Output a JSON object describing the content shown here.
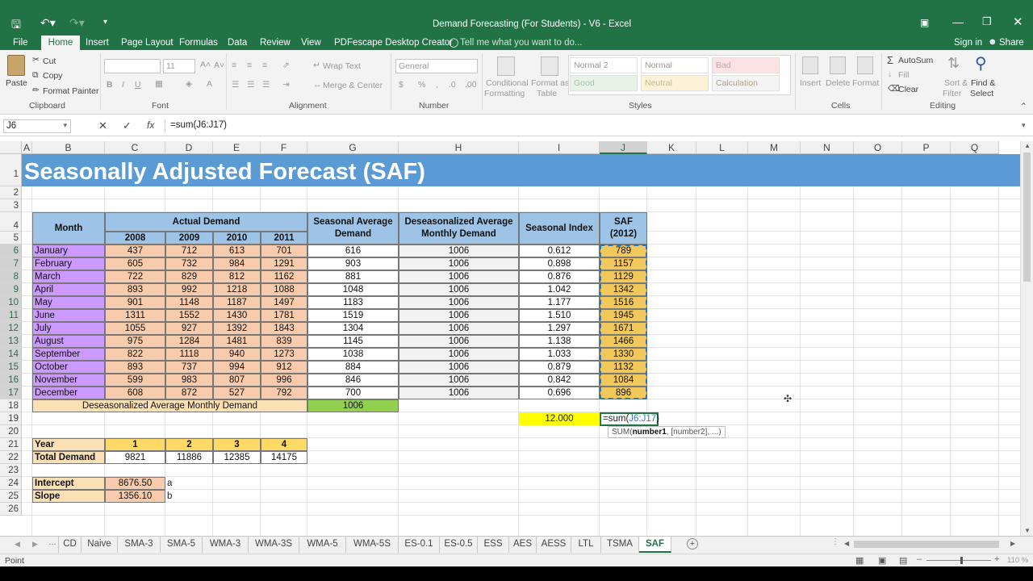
{
  "window": {
    "title": "Demand Forecasting (For Students) - V6 - Excel",
    "sign_in": "Sign in",
    "share": "Share"
  },
  "menu": {
    "items": [
      "File",
      "Home",
      "Insert",
      "Page Layout",
      "Formulas",
      "Data",
      "Review",
      "View",
      "PDFescape Desktop Creator"
    ],
    "tell_me": "Tell me what you want to do..."
  },
  "ribbon": {
    "clipboard": {
      "paste": "Paste",
      "cut": "Cut",
      "copy": "Copy",
      "format_painter": "Format Painter",
      "label": "Clipboard"
    },
    "font": {
      "size": "11",
      "label": "Font"
    },
    "alignment": {
      "wrap_text": "Wrap Text",
      "merge_center": "Merge & Center",
      "label": "Alignment"
    },
    "number": {
      "format": "General",
      "label": "Number"
    },
    "styles": {
      "conditional": [
        "Conditional",
        "Formatting"
      ],
      "format_as_table": [
        "Format as",
        "Table"
      ],
      "cells": [
        "Normal 2",
        "Normal",
        "Bad",
        "Good",
        "Neutral",
        "Calculation"
      ],
      "label": "Styles"
    },
    "cells": {
      "insert": "Insert",
      "delete": "Delete",
      "format": "Format",
      "label": "Cells"
    },
    "editing": {
      "autosum": "AutoSum",
      "fill": "Fill",
      "clear": "Clear",
      "sort": [
        "Sort &",
        "Filter"
      ],
      "find": [
        "Find &",
        "Select"
      ],
      "label": "Editing"
    }
  },
  "formula_bar": {
    "name_box": "J6",
    "formula": "=sum(J6:J17)"
  },
  "columns": [
    "A",
    "B",
    "C",
    "D",
    "E",
    "F",
    "G",
    "H",
    "I",
    "J",
    "K",
    "L",
    "M",
    "N",
    "O",
    "P",
    "Q"
  ],
  "rows": [
    "1",
    "2",
    "3",
    "4",
    "5",
    "6",
    "7",
    "8",
    "9",
    "10",
    "11",
    "12",
    "13",
    "14",
    "15",
    "16",
    "17",
    "18",
    "19",
    "20",
    "21",
    "22",
    "23",
    "24",
    "25",
    "26"
  ],
  "sheet": {
    "title": "Seasonally Adjusted Forecast (SAF)",
    "hdr": {
      "month": "Month",
      "actual": "Actual Demand",
      "years": [
        "2008",
        "2009",
        "2010",
        "2011"
      ],
      "sad": "Seasonal Average Demand",
      "dam": "Deseasonalized Average Monthly Demand",
      "si": "Seasonal Index",
      "saf": "SAF (2012)"
    },
    "months": [
      "January",
      "February",
      "March",
      "April",
      "May",
      "June",
      "July",
      "August",
      "September",
      "October",
      "November",
      "December"
    ],
    "demand": [
      [
        "437",
        "712",
        "613",
        "701"
      ],
      [
        "605",
        "732",
        "984",
        "1291"
      ],
      [
        "722",
        "829",
        "812",
        "1162"
      ],
      [
        "893",
        "992",
        "1218",
        "1088"
      ],
      [
        "901",
        "1148",
        "1187",
        "1497"
      ],
      [
        "1311",
        "1552",
        "1430",
        "1781"
      ],
      [
        "1055",
        "927",
        "1392",
        "1843"
      ],
      [
        "975",
        "1284",
        "1481",
        "839"
      ],
      [
        "822",
        "1118",
        "940",
        "1273"
      ],
      [
        "893",
        "737",
        "994",
        "912"
      ],
      [
        "599",
        "983",
        "807",
        "996"
      ],
      [
        "608",
        "872",
        "527",
        "792"
      ]
    ],
    "sad": [
      "616",
      "903",
      "881",
      "1048",
      "1183",
      "1519",
      "1304",
      "1145",
      "1038",
      "884",
      "846",
      "700"
    ],
    "dam": [
      "1006",
      "1006",
      "1006",
      "1006",
      "1006",
      "1006",
      "1006",
      "1006",
      "1006",
      "1006",
      "1006",
      "1006"
    ],
    "si": [
      "0.612",
      "0.898",
      "0.876",
      "1.042",
      "1.177",
      "1.510",
      "1.297",
      "1.138",
      "1.033",
      "0.879",
      "0.842",
      "0.696"
    ],
    "saf": [
      "789",
      "1157",
      "1129",
      "1342",
      "1516",
      "1945",
      "1671",
      "1466",
      "1330",
      "1132",
      "1084",
      "896"
    ],
    "row18": {
      "label": "Deseasonalized Average Monthly Demand",
      "value": "1006"
    },
    "row19": {
      "sum": "12.000",
      "edit_prefix": "=sum(",
      "edit_ref": "J6:J17",
      "edit_suffix": ")",
      "tooltip_fn": "SUM(",
      "tooltip_arg1": "number1",
      "tooltip_rest": ", [number2], ...)"
    },
    "year_tbl": {
      "year_label": "Year",
      "years": [
        "1",
        "2",
        "3",
        "4"
      ],
      "total_label": "Total Demand",
      "totals": [
        "9821",
        "11886",
        "12385",
        "14175"
      ]
    },
    "reg": {
      "intercept_label": "Intercept",
      "intercept": "8676.50",
      "a": "a",
      "slope_label": "Slope",
      "slope": "1356.10",
      "b": "b"
    }
  },
  "tabs": [
    "CD",
    "Naive",
    "SMA-3",
    "SMA-5",
    "WMA-3",
    "WMA-3S",
    "WMA-5",
    "WMA-5S",
    "ES-0.1",
    "ES-0.5",
    "ESS",
    "AES",
    "AESS",
    "LTL",
    "TSMA",
    "SAF"
  ],
  "status": {
    "mode": "Point",
    "zoom": "110 %"
  },
  "colors": {
    "excel_green": "#217346",
    "title_band": "#5b9bd5",
    "header_blue": "#9dc3e6",
    "month_purple": "#cc99ff",
    "demand_orange": "#f8cbad",
    "saf_gold": "#f2c85b",
    "yellow": "#ffff00",
    "green": "#92d050",
    "light_orange": "#fbe0b5"
  }
}
